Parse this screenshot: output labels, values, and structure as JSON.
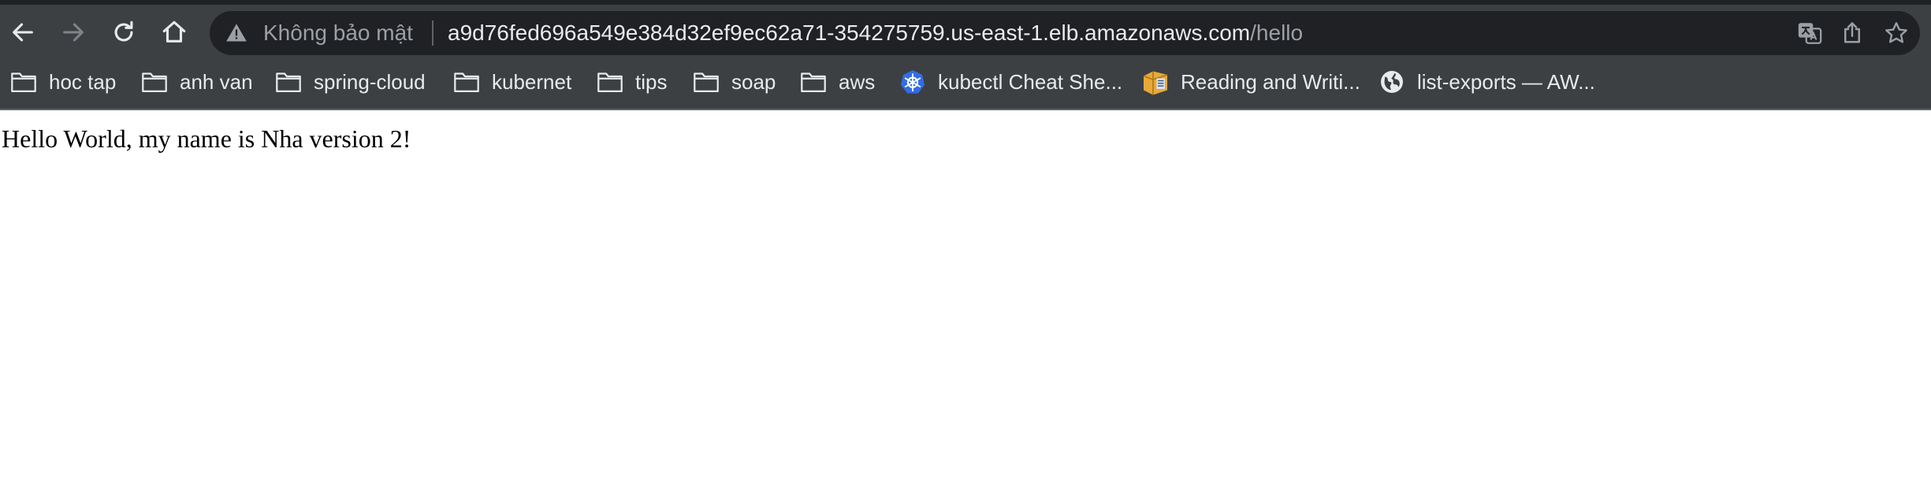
{
  "address_bar": {
    "security_label": "Không bảo mật",
    "url_host": "a9d76fed696a549e384d32ef9ec62a71-354275759.us-east-1.elb.amazonaws.com",
    "url_path": "/hello"
  },
  "bookmarks": [
    {
      "label": "hoc tap",
      "icon": "folder-icon"
    },
    {
      "label": "anh van",
      "icon": "folder-icon"
    },
    {
      "label": "spring-cloud",
      "icon": "folder-icon"
    },
    {
      "label": "kubernet",
      "icon": "folder-icon"
    },
    {
      "label": "tips",
      "icon": "folder-icon"
    },
    {
      "label": "soap",
      "icon": "folder-icon"
    },
    {
      "label": "aws",
      "icon": "folder-icon"
    },
    {
      "label": "kubectl Cheat She...",
      "icon": "kubernetes-icon"
    },
    {
      "label": "Reading and Writi...",
      "icon": "package-icon"
    },
    {
      "label": "list-exports — AW...",
      "icon": "globe-icon"
    }
  ],
  "page": {
    "text": "Hello World, my name is Nha version 2!"
  },
  "colors": {
    "toolbar_bg": "#3c4043",
    "omnibox_bg": "#202124",
    "text_light": "#e8eaed",
    "text_dim": "#9aa0a6",
    "kubernetes_blue": "#326ce5"
  }
}
